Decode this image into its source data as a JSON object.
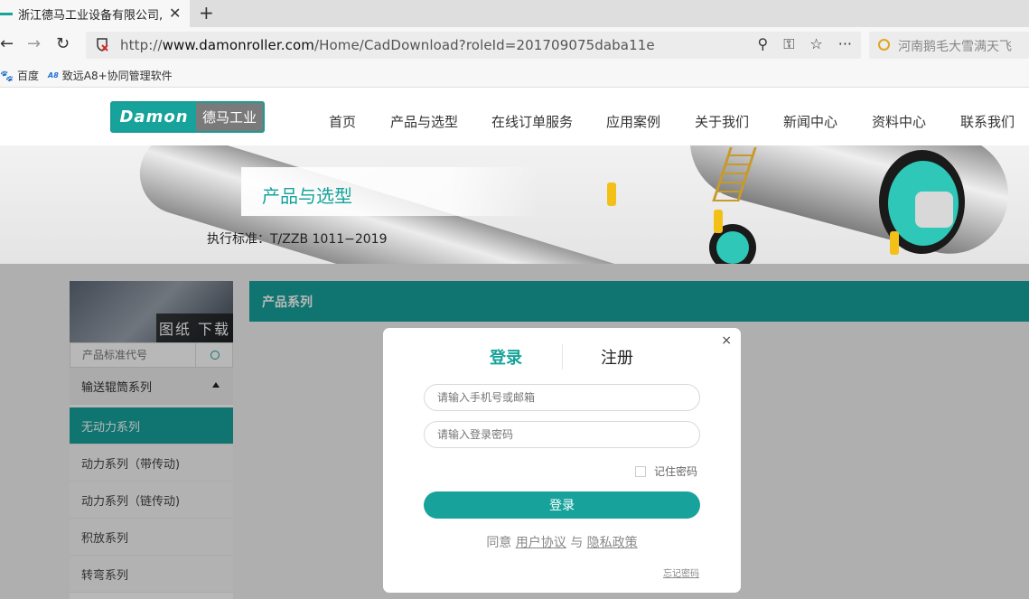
{
  "browser": {
    "tab_title": "浙江德马工业设备有限公司, (",
    "tab_close_glyph": "✕",
    "tab_new_glyph": "+",
    "back_glyph": "←",
    "forward_glyph": "→",
    "reload_glyph": "↻",
    "url_prefix": "http://",
    "url_domain": "www.damonroller.com",
    "url_path": "/Home/CadDownload?roleId=201709075daba11e",
    "zoom_glyph": "⚲",
    "key_glyph": "⚿",
    "star_glyph": "☆",
    "more_glyph": "···",
    "search_text": "河南鹅毛大雪满天飞",
    "bookmarks": [
      {
        "icon": "🐾",
        "label": "百度"
      },
      {
        "icon": "A8",
        "label": "致远A8+协同管理软件"
      }
    ]
  },
  "site": {
    "logo_left": "Damon",
    "logo_right": "德马工业",
    "menu": [
      "首页",
      "产品与选型",
      "在线订单服务",
      "应用案例",
      "关于我们",
      "新闻中心",
      "资料中心",
      "联系我们"
    ],
    "banner_title": "产品与选型",
    "banner_standard": "执行标准：T/ZZB 1011−2019"
  },
  "sidebar": {
    "image_label": "图纸 下载",
    "search_placeholder": "产品标准代号",
    "category": "输送辊筒系列",
    "items": [
      "无动力系列",
      "动力系列（带传动)",
      "动力系列（链传动)",
      "积放系列",
      "转弯系列"
    ]
  },
  "content": {
    "header": "产品系列"
  },
  "modal": {
    "close_glyph": "×",
    "tab_login": "登录",
    "tab_register": "注册",
    "phone_placeholder": "请输入手机号或邮箱",
    "password_placeholder": "请输入登录密码",
    "remember_label": "记住密码",
    "submit_label": "登录",
    "agree_prefix": "同意",
    "agree_user": "用户协议",
    "agree_and": "与",
    "agree_privacy": "隐私政策",
    "forgot_label": "忘记密码"
  },
  "colors": {
    "accent": "#17a39b"
  }
}
